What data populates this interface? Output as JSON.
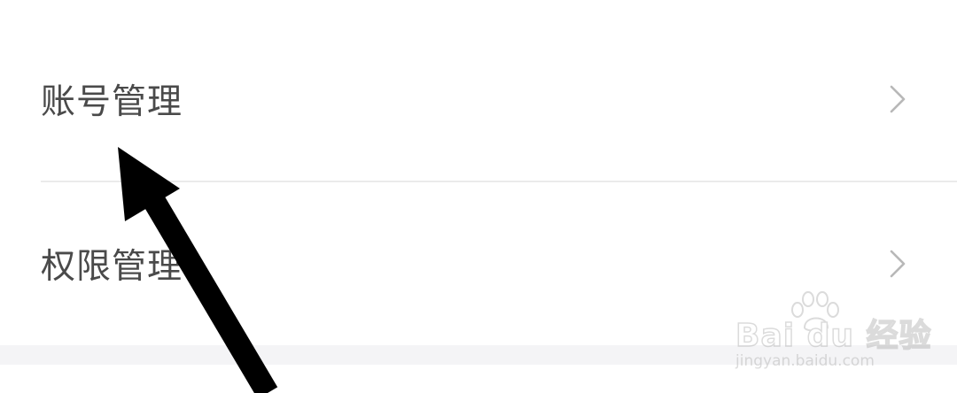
{
  "menu": {
    "items": [
      {
        "label": "账号管理",
        "icon": "chevron-right-icon"
      },
      {
        "label": "权限管理",
        "icon": "chevron-right-icon"
      }
    ]
  },
  "watermark": {
    "brand": "Bai du 经验",
    "domain": "jingyan.baidu.com"
  },
  "colors": {
    "label": "#4a4a4a",
    "chevron": "#b8b8b8",
    "divider": "#ebebeb",
    "section_gap": "#f4f4f6",
    "arrow": "#000000"
  }
}
